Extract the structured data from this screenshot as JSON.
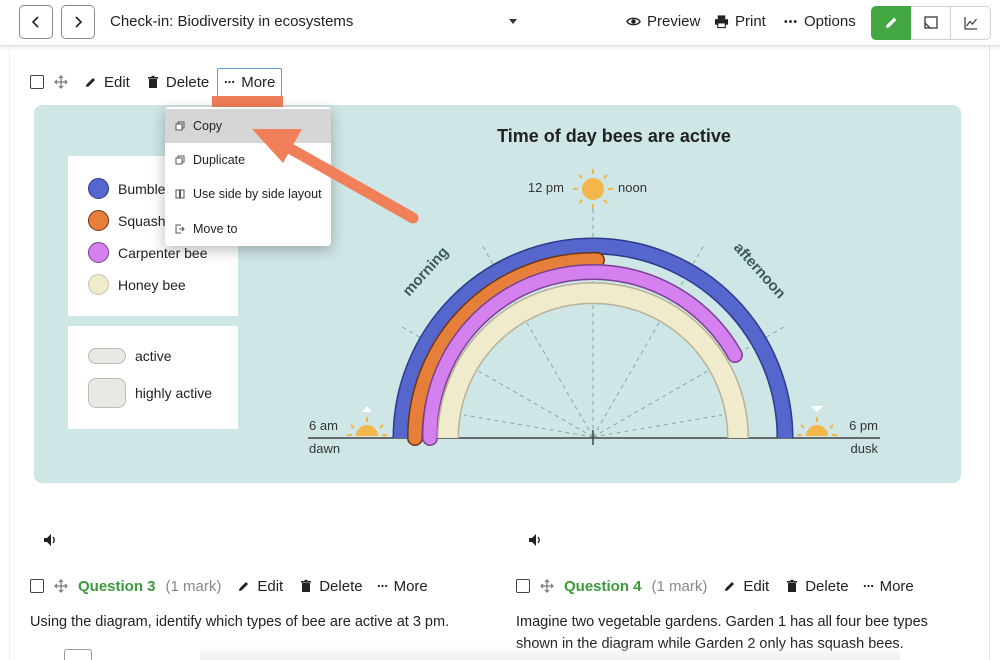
{
  "header": {
    "title": "Check-in: Biodiversity in ecosystems",
    "preview_label": "Preview",
    "print_label": "Print",
    "options_label": "Options",
    "accent": "#43a743"
  },
  "item_toolbar": {
    "edit_label": "Edit",
    "delete_label": "Delete",
    "more_label": "More"
  },
  "more_menu": {
    "items": [
      {
        "label": "Copy",
        "icon": "copy-icon"
      },
      {
        "label": "Duplicate",
        "icon": "duplicate-icon"
      },
      {
        "label": "Use side by side layout",
        "icon": "columns-icon"
      },
      {
        "label": "Move to",
        "icon": "move-to-icon"
      }
    ],
    "highlight_color": "#f07f5a"
  },
  "diagram": {
    "title": "Time of day bees are active",
    "legend": [
      {
        "label": "Bumblebee",
        "color": "#5566cc"
      },
      {
        "label": "Squash bee",
        "color": "#e67f3a"
      },
      {
        "label": "Carpenter bee",
        "color": "#d580ef"
      },
      {
        "label": "Honey bee",
        "color": "#f0ebcc"
      }
    ],
    "activity_legend": [
      "active",
      "highly active"
    ],
    "labels": {
      "noon_time": "12 pm",
      "noon": "noon",
      "morning": "morning",
      "afternoon": "afternoon",
      "dawn_time": "6 am",
      "dawn": "dawn",
      "dusk_time": "6 pm",
      "dusk": "dusk"
    }
  },
  "questions": [
    {
      "title": "Question 3",
      "marks": "(1 mark)",
      "text": "Using the diagram, identify which types of bee are active at 3 pm."
    },
    {
      "title": "Question 4",
      "marks": "(1 mark)",
      "text": "Imagine two vegetable gardens. Garden 1 has all four bee types shown in the diagram while Garden 2 only has squash bees."
    }
  ]
}
